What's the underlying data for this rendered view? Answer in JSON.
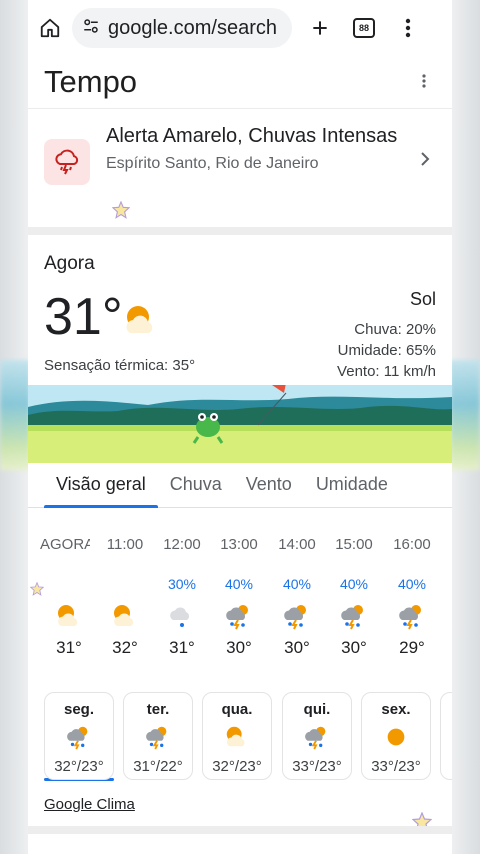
{
  "browser": {
    "url": "google.com/search",
    "tab_count": "88"
  },
  "page": {
    "title": "Tempo"
  },
  "alert": {
    "title": "Alerta Amarelo, Chuvas Intensas",
    "subtitle": "Espírito Santo, Rio de Janeiro",
    "icon": "storm-warning-icon"
  },
  "now": {
    "label": "Agora",
    "temperature": "31°",
    "feels_like": "Sensação térmica: 35°",
    "condition": "Sol",
    "rain": "Chuva: 20%",
    "humidity": "Umidade: 65%",
    "wind": "Vento: 11 km/h"
  },
  "tabs": [
    "Visão geral",
    "Chuva",
    "Vento",
    "Umidade"
  ],
  "hourly": [
    {
      "hour": "AGORA",
      "precip": "",
      "icon": "partly-sunny-icon",
      "temp": "31°"
    },
    {
      "hour": "11:00",
      "precip": "",
      "icon": "partly-sunny-icon",
      "temp": "32°"
    },
    {
      "hour": "12:00",
      "precip": "30%",
      "icon": "rain-cloud-icon",
      "temp": "31°"
    },
    {
      "hour": "13:00",
      "precip": "40%",
      "icon": "thunderstorm-icon",
      "temp": "30°"
    },
    {
      "hour": "14:00",
      "precip": "40%",
      "icon": "thunderstorm-icon",
      "temp": "30°"
    },
    {
      "hour": "15:00",
      "precip": "40%",
      "icon": "thunderstorm-icon",
      "temp": "30°"
    },
    {
      "hour": "16:00",
      "precip": "40%",
      "icon": "thunderstorm-icon",
      "temp": "29°"
    }
  ],
  "daily": [
    {
      "day": "seg.",
      "icon": "thunderstorm-icon",
      "temps": "32°/23°"
    },
    {
      "day": "ter.",
      "icon": "thunderstorm-icon",
      "temps": "31°/22°"
    },
    {
      "day": "qua.",
      "icon": "partly-sunny-icon",
      "temps": "32°/23°"
    },
    {
      "day": "qui.",
      "icon": "thunderstorm-icon",
      "temps": "33°/23°"
    },
    {
      "day": "sex.",
      "icon": "sunny-icon",
      "temps": "33°/23°"
    }
  ],
  "footer": {
    "link": "Google Clima"
  },
  "colors": {
    "accent": "#1a73e8",
    "alert_bg": "#fbe4e3",
    "alert_icon": "#c5221f",
    "sun": "#f29900"
  }
}
